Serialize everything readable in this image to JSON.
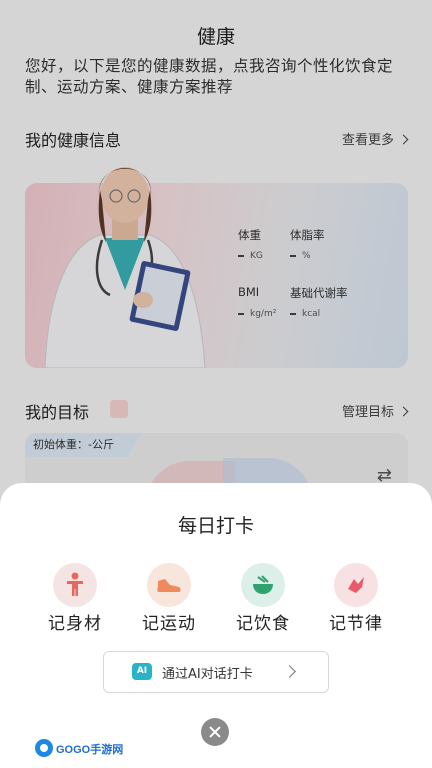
{
  "header": {
    "title": "健康",
    "intro": "您好，以下是您的健康数据，点我咨询个性化饮食定制、运动方案、健康方案推荐"
  },
  "health_info": {
    "heading": "我的健康信息",
    "more_label": "查看更多",
    "metrics": [
      {
        "label": "体重",
        "value": "-",
        "unit": "KG"
      },
      {
        "label": "体脂率",
        "value": "-",
        "unit": "%"
      },
      {
        "label": "BMI",
        "value": "-",
        "unit": "kg/m²"
      },
      {
        "label": "基础代谢率",
        "value": "-",
        "unit": "kcal"
      }
    ]
  },
  "goals": {
    "heading": "我的目标",
    "manage_label": "管理目标",
    "initial_weight": "初始体重：-公斤"
  },
  "checkin_sheet": {
    "title": "每日打卡",
    "actions": [
      {
        "label": "记身材",
        "icon": "body-icon",
        "color": "#f5e4e4"
      },
      {
        "label": "记运动",
        "icon": "shoe-icon",
        "color": "#f8e6dc"
      },
      {
        "label": "记饮食",
        "icon": "bowl-icon",
        "color": "#dcefe8"
      },
      {
        "label": "记节律",
        "icon": "rhythm-icon",
        "color": "#f8e1e3"
      }
    ],
    "ai_button_badge": "AI",
    "ai_button_label": "通过AI对话打卡"
  },
  "watermark": {
    "brand": "GOGO手游网"
  },
  "colors": {
    "accent_teal": "#2ab3c8",
    "sheet_bg": "#ffffff",
    "close_gray": "#8a8a8a"
  }
}
